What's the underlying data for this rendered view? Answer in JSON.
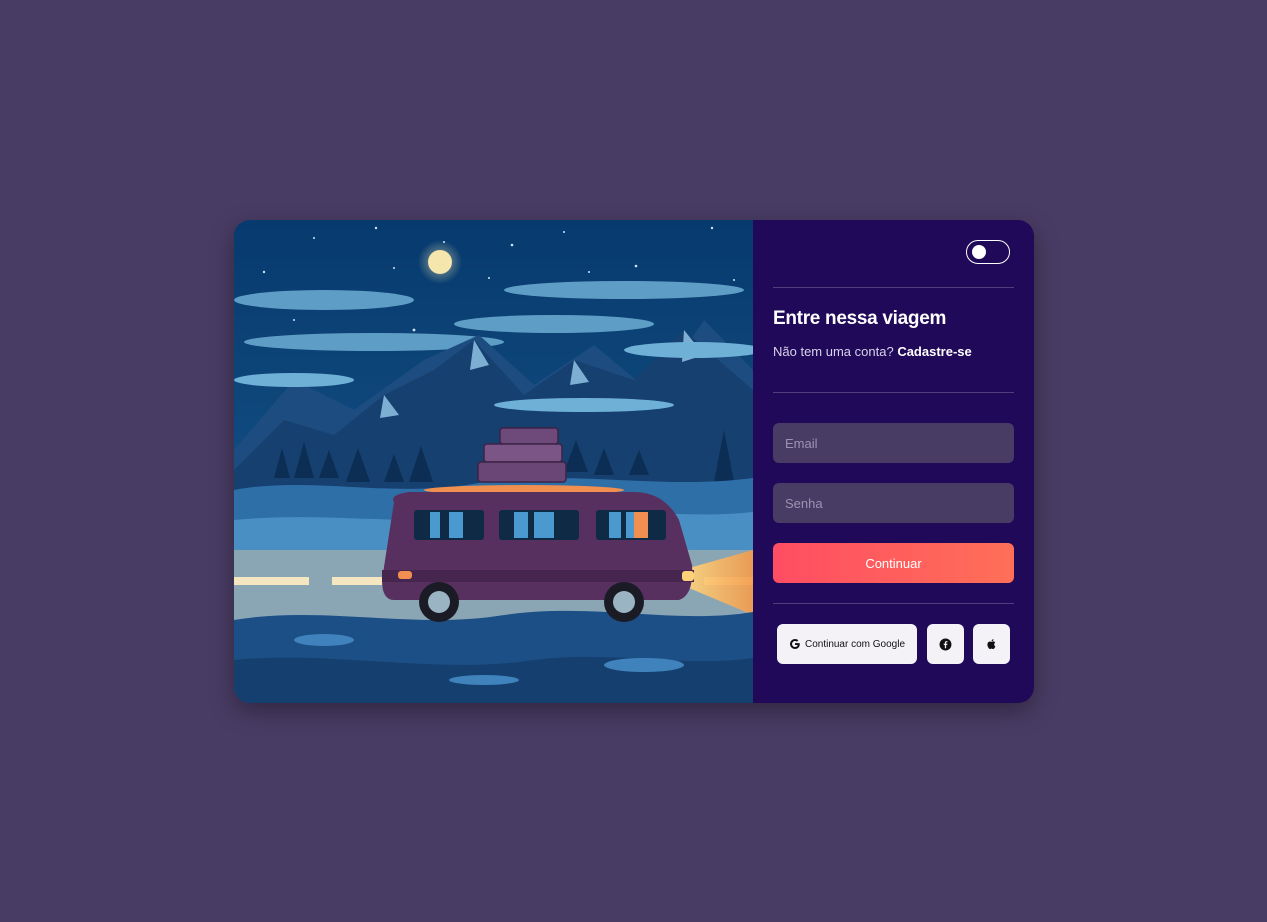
{
  "login": {
    "title": "Entre nessa viagem",
    "subtitle_prompt": "Não tem uma conta?",
    "signup_link": "Cadastre-se",
    "email_placeholder": "Email",
    "password_placeholder": "Senha",
    "continue_label": "Continuar",
    "google_label": "Continuar com Google",
    "theme_toggle": {
      "on": false
    }
  },
  "colors": {
    "page_background": "#493c64",
    "panel_background": "#200959",
    "input_background": "#493c64",
    "button_gradient_start": "#ff4d63",
    "button_gradient_end": "#ff6f57",
    "social_button_background": "#f4f2f7"
  },
  "icons": {
    "google": "google-icon",
    "facebook": "facebook-icon",
    "apple": "apple-icon"
  }
}
